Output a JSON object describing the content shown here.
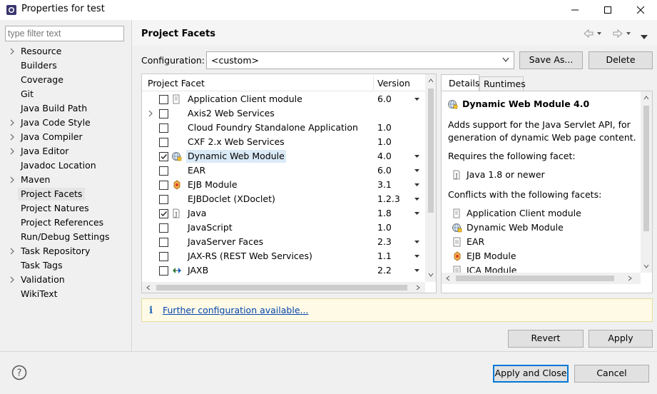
{
  "window": {
    "title": "Properties for test",
    "controls": [
      "minimize",
      "maximize",
      "close"
    ]
  },
  "sidebar": {
    "filter_placeholder": "type filter text",
    "items": [
      {
        "label": "Resource",
        "expandable": true
      },
      {
        "label": "Builders",
        "expandable": false
      },
      {
        "label": "Coverage",
        "expandable": false
      },
      {
        "label": "Git",
        "expandable": false
      },
      {
        "label": "Java Build Path",
        "expandable": false
      },
      {
        "label": "Java Code Style",
        "expandable": true
      },
      {
        "label": "Java Compiler",
        "expandable": true
      },
      {
        "label": "Java Editor",
        "expandable": true
      },
      {
        "label": "Javadoc Location",
        "expandable": false
      },
      {
        "label": "Maven",
        "expandable": true
      },
      {
        "label": "Project Facets",
        "expandable": false,
        "selected": true
      },
      {
        "label": "Project Natures",
        "expandable": false
      },
      {
        "label": "Project References",
        "expandable": false
      },
      {
        "label": "Run/Debug Settings",
        "expandable": false
      },
      {
        "label": "Task Repository",
        "expandable": true
      },
      {
        "label": "Task Tags",
        "expandable": false
      },
      {
        "label": "Validation",
        "expandable": true
      },
      {
        "label": "WikiText",
        "expandable": false
      }
    ]
  },
  "header": {
    "title": "Project Facets"
  },
  "configuration": {
    "label": "Configuration:",
    "value": "<custom>",
    "save_as_label": "Save As...",
    "delete_label": "Delete"
  },
  "facets": {
    "col_facet": "Project Facet",
    "col_version": "Version",
    "rows": [
      {
        "name": "Application Client module",
        "version": "6.0",
        "checked": false,
        "has_dropdown": true,
        "expandable": false,
        "icon": "app-client-icon"
      },
      {
        "name": "Axis2 Web Services",
        "version": "",
        "checked": false,
        "has_dropdown": false,
        "expandable": true,
        "icon": "none"
      },
      {
        "name": "Cloud Foundry Standalone Application",
        "version": "1.0",
        "checked": false,
        "has_dropdown": false,
        "expandable": false,
        "icon": "none"
      },
      {
        "name": "CXF 2.x Web Services",
        "version": "1.0",
        "checked": false,
        "has_dropdown": false,
        "expandable": false,
        "icon": "none"
      },
      {
        "name": "Dynamic Web Module",
        "version": "4.0",
        "checked": true,
        "has_dropdown": true,
        "expandable": false,
        "icon": "web-module-icon",
        "highlighted": true
      },
      {
        "name": "EAR",
        "version": "6.0",
        "checked": false,
        "has_dropdown": true,
        "expandable": false,
        "icon": "none"
      },
      {
        "name": "EJB Module",
        "version": "3.1",
        "checked": false,
        "has_dropdown": true,
        "expandable": false,
        "icon": "ejb-icon"
      },
      {
        "name": "EJBDoclet (XDoclet)",
        "version": "1.2.3",
        "checked": false,
        "has_dropdown": true,
        "expandable": false,
        "icon": "none"
      },
      {
        "name": "Java",
        "version": "1.8",
        "checked": true,
        "has_dropdown": true,
        "expandable": false,
        "icon": "java-icon"
      },
      {
        "name": "JavaScript",
        "version": "1.0",
        "checked": false,
        "has_dropdown": false,
        "expandable": false,
        "icon": "none"
      },
      {
        "name": "JavaServer Faces",
        "version": "2.3",
        "checked": false,
        "has_dropdown": true,
        "expandable": false,
        "icon": "none"
      },
      {
        "name": "JAX-RS (REST Web Services)",
        "version": "1.1",
        "checked": false,
        "has_dropdown": true,
        "expandable": false,
        "icon": "none"
      },
      {
        "name": "JAXB",
        "version": "2.2",
        "checked": false,
        "has_dropdown": true,
        "expandable": false,
        "icon": "jaxb-icon"
      }
    ]
  },
  "details": {
    "tab_details": "Details",
    "tab_runtimes": "Runtimes",
    "title": "Dynamic Web Module 4.0",
    "description_line1": "Adds support for the Java Servlet API, for",
    "description_line2": "generation of dynamic Web page content.",
    "requires_label": "Requires the following facet:",
    "requires": [
      {
        "label": "Java 1.8 or newer",
        "icon": "java-icon"
      }
    ],
    "conflicts_label": "Conflicts with the following facets:",
    "conflicts": [
      {
        "label": "Application Client module",
        "icon": "app-client-icon"
      },
      {
        "label": "Dynamic Web Module",
        "icon": "web-module-icon"
      },
      {
        "label": "EAR",
        "icon": "ear-icon"
      },
      {
        "label": "EJB Module",
        "icon": "ejb-icon"
      },
      {
        "label": "JCA Module",
        "icon": "jca-icon"
      }
    ]
  },
  "infobar": {
    "icon": "info-icon",
    "link": "Further configuration available..."
  },
  "buttons": {
    "revert": "Revert",
    "apply": "Apply",
    "apply_and_close": "Apply and Close",
    "cancel": "Cancel"
  },
  "colors": {
    "accent": "#0078d7",
    "selection": "#dbeaf7",
    "info_bg": "#fffae6",
    "link": "#0645ad"
  }
}
